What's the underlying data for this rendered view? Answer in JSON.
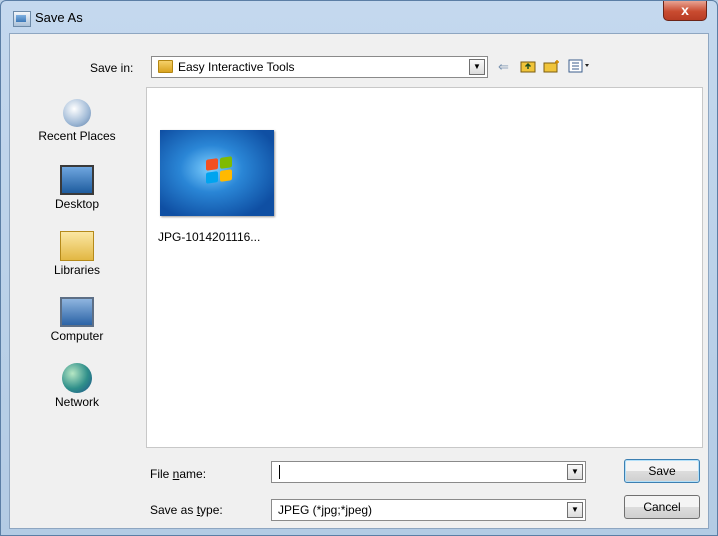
{
  "window": {
    "title": "Save As",
    "close_glyph": "x"
  },
  "toolbar": {
    "save_in_label": "Save in:",
    "save_in_value": "Easy Interactive Tools",
    "icons": [
      "back-arrow-icon",
      "up-folder-icon",
      "new-folder-icon",
      "view-menu-icon"
    ]
  },
  "places": [
    {
      "label": "Recent Places",
      "icon": "recent-places-icon"
    },
    {
      "label": "Desktop",
      "icon": "desktop-icon"
    },
    {
      "label": "Libraries",
      "icon": "libraries-icon"
    },
    {
      "label": "Computer",
      "icon": "computer-icon"
    },
    {
      "label": "Network",
      "icon": "network-icon"
    }
  ],
  "files": [
    {
      "name": "JPG-1014201116..."
    }
  ],
  "form": {
    "file_name_label": "File name:",
    "file_name_value": "",
    "save_as_type_label": "Save as type:",
    "save_as_type_value": "JPEG (*jpg;*jpeg)"
  },
  "buttons": {
    "save": "Save",
    "cancel": "Cancel"
  },
  "colors": {
    "title_bar": "#c4d8ee",
    "close_button": "#c94b30",
    "accent_blue": "#2a86d6"
  }
}
